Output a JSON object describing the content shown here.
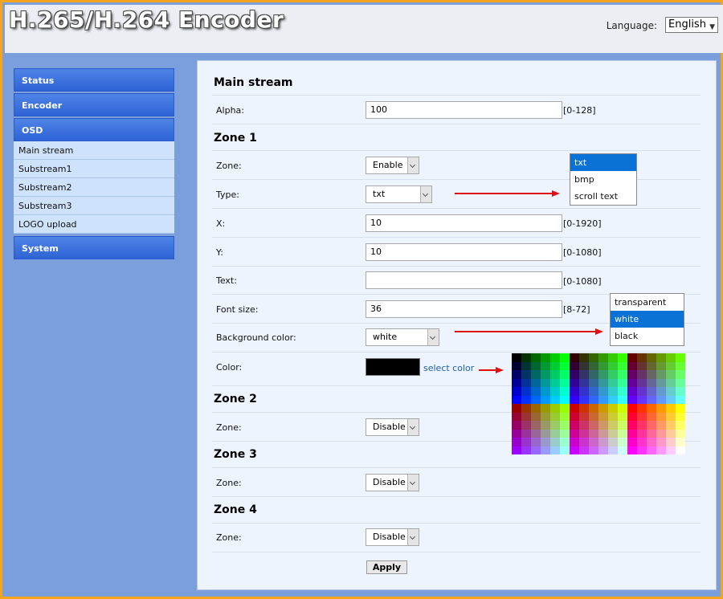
{
  "header": {
    "title": "H.265/H.264 Encoder",
    "language_label": "Language:",
    "language_value": "English"
  },
  "sidebar": {
    "items": [
      {
        "label": "Status",
        "type": "head"
      },
      {
        "label": "Encoder",
        "type": "head"
      },
      {
        "label": "OSD",
        "type": "head"
      },
      {
        "label": "Main stream",
        "type": "sub"
      },
      {
        "label": "Substream1",
        "type": "sub"
      },
      {
        "label": "Substream2",
        "type": "sub"
      },
      {
        "label": "Substream3",
        "type": "sub"
      },
      {
        "label": "LOGO upload",
        "type": "sub"
      },
      {
        "label": "System",
        "type": "head"
      }
    ]
  },
  "main": {
    "title": "Main stream",
    "alpha": {
      "label": "Alpha:",
      "value": "100",
      "range": "[0-128]"
    },
    "zone1": {
      "title": "Zone 1",
      "zone": {
        "label": "Zone:",
        "value": "Enable"
      },
      "type": {
        "label": "Type:",
        "value": "txt"
      },
      "x": {
        "label": "X:",
        "value": "10",
        "range": "[0-1920]"
      },
      "y": {
        "label": "Y:",
        "value": "10",
        "range": "[0-1080]"
      },
      "text": {
        "label": "Text:",
        "value": "",
        "range": "[0-1080]"
      },
      "font_size": {
        "label": "Font size:",
        "value": "36",
        "range": "[8-72]"
      },
      "background_color": {
        "label": "Background color:",
        "value": "white"
      },
      "color": {
        "label": "Color:",
        "swatch": "#000000",
        "link": "select color"
      }
    },
    "zone2": {
      "title": "Zone 2",
      "zone": {
        "label": "Zone:",
        "value": "Disable"
      }
    },
    "zone3": {
      "title": "Zone 3",
      "zone": {
        "label": "Zone:",
        "value": "Disable"
      }
    },
    "zone4": {
      "title": "Zone 4",
      "zone": {
        "label": "Zone:",
        "value": "Disable"
      }
    },
    "apply_label": "Apply"
  },
  "popups": {
    "type_options": [
      "txt",
      "bmp",
      "scroll text"
    ],
    "type_selected": "txt",
    "bg_options": [
      "transparent",
      "white",
      "black"
    ],
    "bg_selected": "white"
  },
  "colors": {
    "accent": "#2e63d6",
    "highlight": "#0a72d6",
    "annotation_arrow": "#e01010",
    "border": "#f5a41c"
  }
}
